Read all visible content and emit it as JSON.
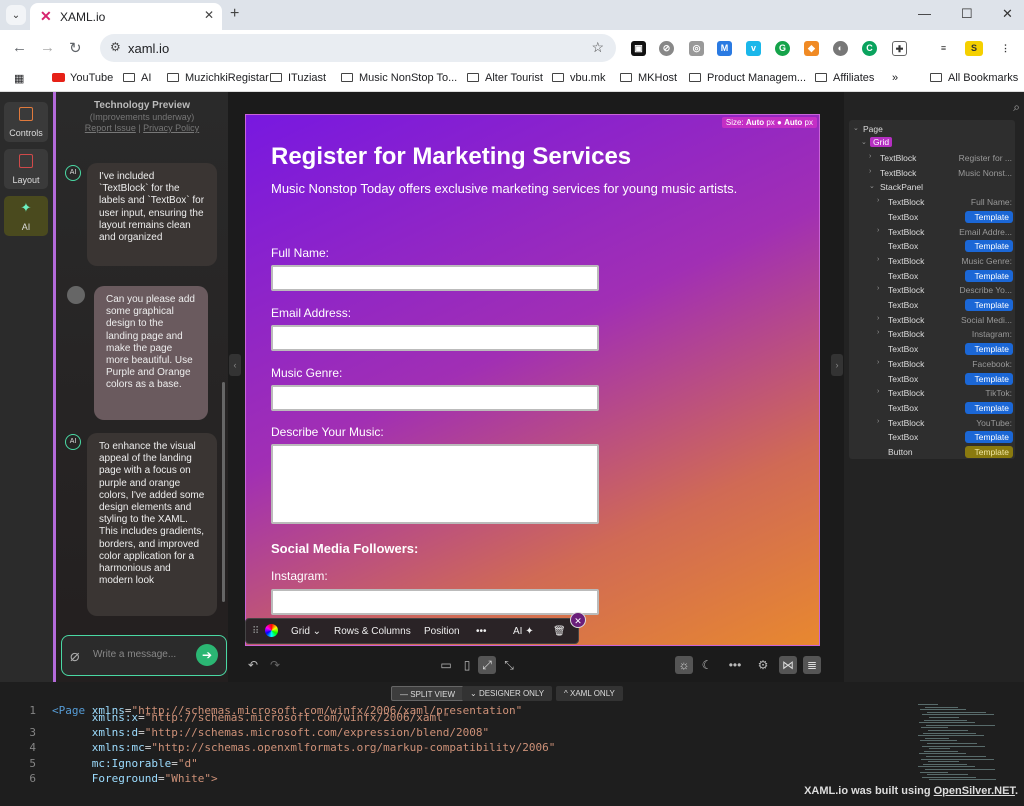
{
  "browser": {
    "tab_title": "XAML.io",
    "url": "xaml.io",
    "bookmarks": [
      "YouTube",
      "AI",
      "MuzichkiRegistar",
      "ITuziast",
      "Music NonStop To...",
      "Alter Tourist",
      "vbu.mk",
      "MKHost",
      "Product Managem...",
      "Affiliates",
      "All Bookmarks"
    ],
    "more_bookmarks": "»"
  },
  "leftbar": {
    "items": [
      "Controls",
      "Layout",
      "AI"
    ]
  },
  "chat": {
    "header_title": "Technology Preview",
    "header_sub": "(Improvements underway)",
    "link_report": "Report Issue",
    "link_sep": " | ",
    "link_privacy": "Privacy Policy",
    "avatar_ai": "AI",
    "messages": [
      "I've included `TextBlock` for the labels and `TextBox` for user input, ensuring the layout remains clean and organized",
      "Can you please add some graphical design to the landing page and make the page more beautiful. Use Purple and Orange colors as a base.",
      "To enhance the visual appeal of the landing page with a focus on purple and orange colors, I've added some design elements and styling to the XAML. This includes gradients, borders, and improved color application for a harmonious and modern look"
    ],
    "input_placeholder": "Write a message..."
  },
  "design": {
    "size_label": "Size:",
    "size_w": "Auto",
    "size_unit": "px",
    "size_h": "Auto",
    "title": "Register for Marketing Services",
    "subtitle": "Music Nonstop Today offers exclusive marketing services for young music artists.",
    "labels": [
      "Full Name:",
      "Email Address:",
      "Music Genre:",
      "Describe Your Music:",
      "Social Media Followers:",
      "Instagram:"
    ]
  },
  "floatbar": {
    "grid": "Grid",
    "rows_cols": "Rows & Columns",
    "position": "Position",
    "more": "•••",
    "ai": "AI"
  },
  "tree": {
    "root": "Page",
    "grid": "Grid",
    "rows": [
      {
        "name": "TextBlock",
        "val": "Register for ..."
      },
      {
        "name": "TextBlock",
        "val": "Music Nonst..."
      },
      {
        "name": "StackPanel",
        "val": ""
      },
      {
        "name": "TextBlock",
        "val": "Full Name:"
      },
      {
        "name": "TextBox",
        "tpl": "Template"
      },
      {
        "name": "TextBlock",
        "val": "Email Addre..."
      },
      {
        "name": "TextBox",
        "tpl": "Template"
      },
      {
        "name": "TextBlock",
        "val": "Music Genre:"
      },
      {
        "name": "TextBox",
        "tpl": "Template"
      },
      {
        "name": "TextBlock",
        "val": "Describe Yo..."
      },
      {
        "name": "TextBox",
        "tpl": "Template"
      },
      {
        "name": "TextBlock",
        "val": "Social Medi..."
      },
      {
        "name": "TextBlock",
        "val": "Instagram:"
      },
      {
        "name": "TextBox",
        "tpl": "Template"
      },
      {
        "name": "TextBlock",
        "val": "Facebook:"
      },
      {
        "name": "TextBox",
        "tpl": "Template"
      },
      {
        "name": "TextBlock",
        "val": "TikTok:"
      },
      {
        "name": "TextBox",
        "tpl": "Template"
      },
      {
        "name": "TextBlock",
        "val": "YouTube:"
      },
      {
        "name": "TextBox",
        "tpl": "Template"
      },
      {
        "name": "Button",
        "tpl": "Template"
      }
    ]
  },
  "viewbar": [
    "SPLIT VIEW",
    "DESIGNER ONLY",
    "XAML ONLY"
  ],
  "code_lines": [
    {
      "n": "1",
      "parts": [
        [
          "tag",
          "<Page "
        ],
        [
          "attr",
          "xmlns"
        ],
        [
          "plain",
          "="
        ],
        [
          "str",
          "\"http://schemas.microsoft.com/winfx/2006/xaml/presentation\""
        ]
      ]
    },
    {
      "n": "",
      "parts": [
        [
          "attr",
          "      xmlns:x"
        ],
        [
          "plain",
          "="
        ],
        [
          "str",
          "\"http://schemas.microsoft.com/winfx/2006/xaml\""
        ]
      ]
    },
    {
      "n": "3",
      "parts": [
        [
          "attr",
          "      xmlns:d"
        ],
        [
          "plain",
          "="
        ],
        [
          "str",
          "\"http://schemas.microsoft.com/expression/blend/2008\""
        ]
      ]
    },
    {
      "n": "4",
      "parts": [
        [
          "attr",
          "      xmlns:mc"
        ],
        [
          "plain",
          "="
        ],
        [
          "str",
          "\"http://schemas.openxmlformats.org/markup-compatibility/2006\""
        ]
      ]
    },
    {
      "n": "5",
      "parts": [
        [
          "attr",
          "      mc:Ignorable"
        ],
        [
          "plain",
          "="
        ],
        [
          "str",
          "\"d\""
        ]
      ]
    },
    {
      "n": "6",
      "parts": [
        [
          "attr",
          "      Foreground"
        ],
        [
          "plain",
          "="
        ],
        [
          "str",
          "\"White\">"
        ]
      ]
    }
  ],
  "footer": {
    "prefix": "XAML.io was built using ",
    "link": "OpenSilver.NET",
    "suffix": "."
  }
}
